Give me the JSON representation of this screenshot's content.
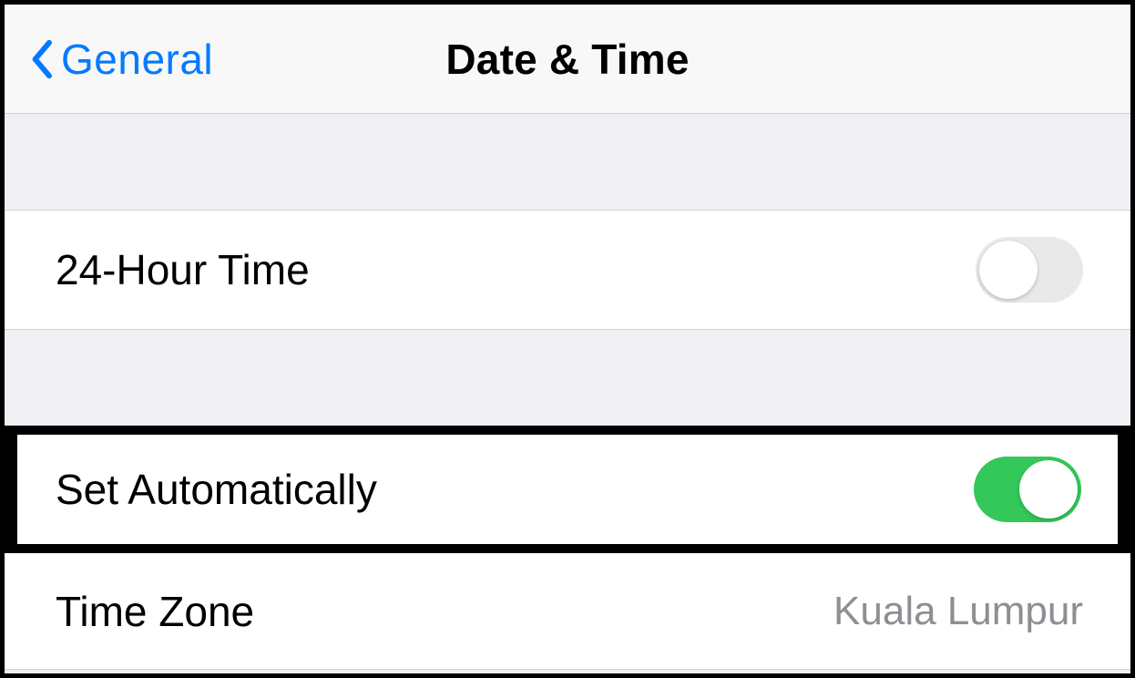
{
  "nav": {
    "back_label": "General",
    "title": "Date & Time"
  },
  "rows": {
    "hour24": {
      "label": "24-Hour Time",
      "on": false
    },
    "set_auto": {
      "label": "Set Automatically",
      "on": true
    },
    "time_zone": {
      "label": "Time Zone",
      "value": "Kuala Lumpur"
    }
  }
}
